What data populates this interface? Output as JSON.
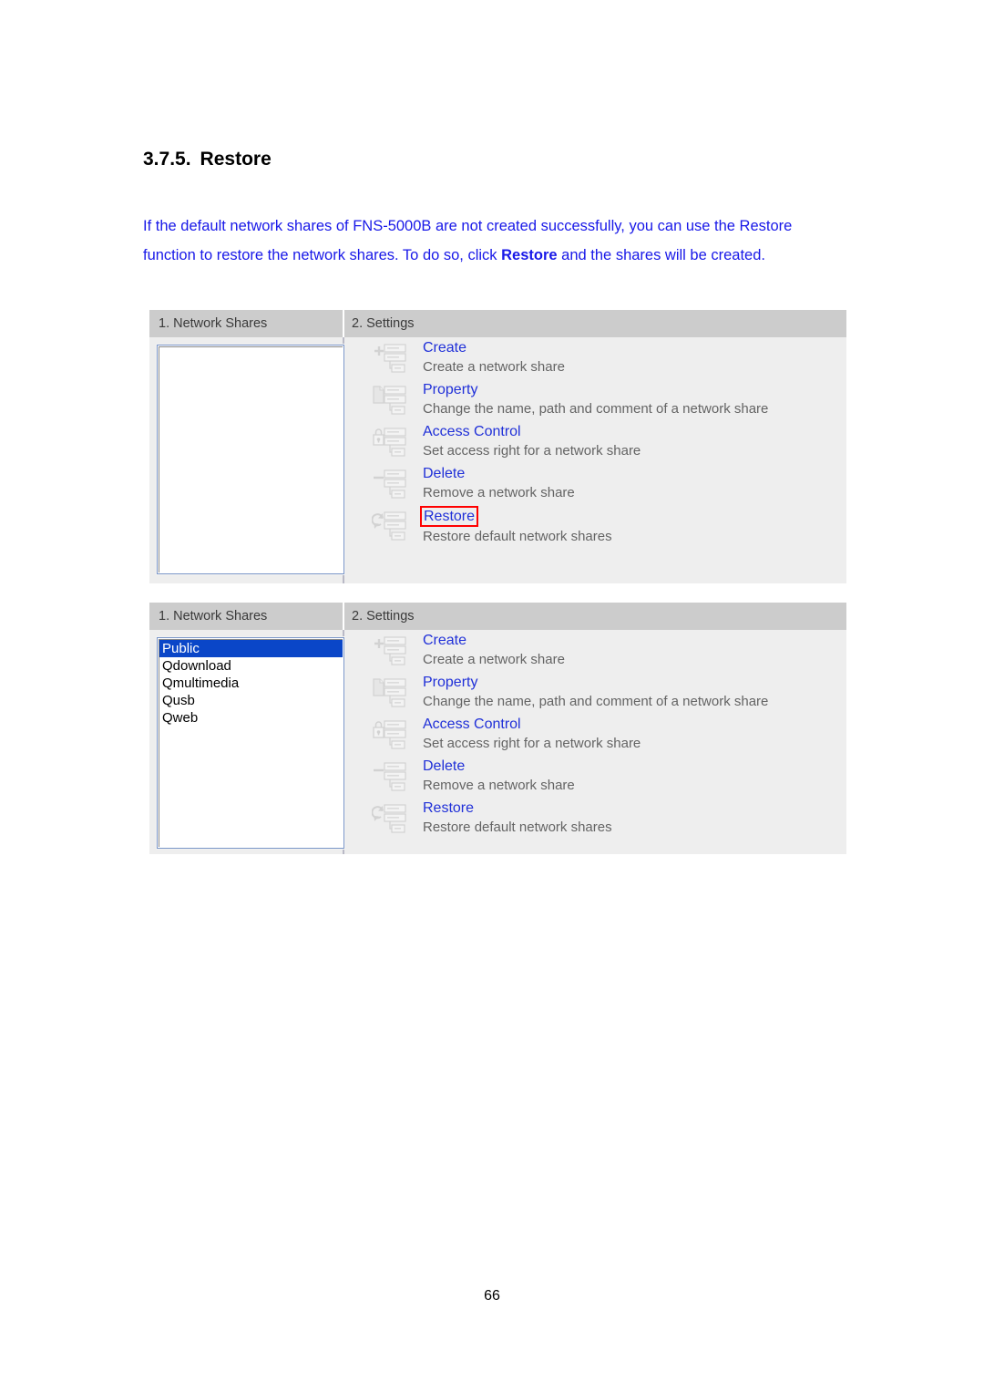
{
  "document": {
    "heading_number": "3.7.5.",
    "heading_title": "Restore",
    "paragraph_part1": "If the default network shares of FNS-5000B are not created successfully, you can use the Restore function to restore the network shares.  To do so, click ",
    "paragraph_bold": "Restore",
    "paragraph_part2": " and the shares will be created.",
    "page_number": "66"
  },
  "colors": {
    "body_text": "#1818e8",
    "link": "#2030d8",
    "description": "#646464",
    "highlight_border": "#ff0000",
    "selection": "#0a46c8",
    "panel_bg": "#eeeeee",
    "header_bg": "#cccccc"
  },
  "screenshot_one": {
    "tabs": {
      "network_shares": "1. Network Shares",
      "settings": "2. Settings"
    },
    "shares": [],
    "settings": [
      {
        "icon": "add-server-icon",
        "label": "Create",
        "description": "Create a network share",
        "highlighted": false
      },
      {
        "icon": "document-server-icon",
        "label": "Property",
        "description": "Change the name, path and comment of a network share",
        "highlighted": false
      },
      {
        "icon": "lock-server-icon",
        "label": "Access Control",
        "description": "Set access right for a network share",
        "highlighted": false
      },
      {
        "icon": "remove-server-icon",
        "label": "Delete",
        "description": "Remove a network share",
        "highlighted": false
      },
      {
        "icon": "refresh-server-icon",
        "label": "Restore",
        "description": "Restore default network shares",
        "highlighted": true
      }
    ]
  },
  "screenshot_two": {
    "tabs": {
      "network_shares": "1. Network Shares",
      "settings": "2. Settings"
    },
    "shares": [
      {
        "name": "Public",
        "selected": true
      },
      {
        "name": "Qdownload",
        "selected": false
      },
      {
        "name": "Qmultimedia",
        "selected": false
      },
      {
        "name": "Qusb",
        "selected": false
      },
      {
        "name": "Qweb",
        "selected": false
      }
    ],
    "settings": [
      {
        "icon": "add-server-icon",
        "label": "Create",
        "description": "Create a network share",
        "highlighted": false
      },
      {
        "icon": "document-server-icon",
        "label": "Property",
        "description": "Change the name, path and comment of a network share",
        "highlighted": false
      },
      {
        "icon": "lock-server-icon",
        "label": "Access Control",
        "description": "Set access right for a network share",
        "highlighted": false
      },
      {
        "icon": "remove-server-icon",
        "label": "Delete",
        "description": "Remove a network share",
        "highlighted": false
      },
      {
        "icon": "refresh-server-icon",
        "label": "Restore",
        "description": "Restore default network shares",
        "highlighted": false
      }
    ]
  }
}
